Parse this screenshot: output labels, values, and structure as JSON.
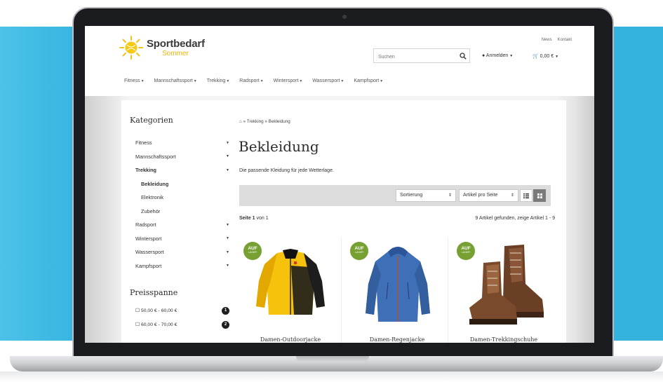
{
  "colors": {
    "accent": "#e9b40c",
    "badge": "#77a033",
    "backdrop": "#35b3df"
  },
  "top_links": [
    "News",
    "Kontakt"
  ],
  "logo": {
    "title": "Sportbedarf",
    "subtitle": "Sommer",
    "icon": "sun-logo-icon"
  },
  "search": {
    "placeholder": "Suchen",
    "icon": "search-icon"
  },
  "account": {
    "label": "Anmelden",
    "icon": "user-icon"
  },
  "cart": {
    "label": "0,00 €",
    "icon": "cart-icon"
  },
  "nav": [
    "Fitness",
    "Mannschaftssport",
    "Trekking",
    "Radsport",
    "Wintersport",
    "Wassersport",
    "Kampfsport"
  ],
  "sidebar": {
    "heading": "Kategorien",
    "items": [
      {
        "label": "Fitness"
      },
      {
        "label": "Mannschaftssport"
      },
      {
        "label": "Trekking"
      },
      {
        "label": "Bekleidung"
      },
      {
        "label": "Elektronik"
      },
      {
        "label": "Zubehör"
      },
      {
        "label": "Radsport"
      },
      {
        "label": "Wintersport"
      },
      {
        "label": "Wassersport"
      },
      {
        "label": "Kampfsport"
      }
    ],
    "price_heading": "Preisspanne",
    "prices": [
      {
        "label": "50,00 € - 60,00 €",
        "count": "1"
      },
      {
        "label": "60,00 € - 70,00 €",
        "count": "2"
      }
    ]
  },
  "breadcrumb": {
    "home_icon": "home-icon",
    "text": "» Trekking » Bekleidung"
  },
  "page": {
    "title": "Bekleidung",
    "description": "Die passende Kleidung für jede Wetterlage."
  },
  "toolbar": {
    "sort": "Sortierung",
    "per_page": "Artikel pro Seite",
    "list_icon": "list-view-icon",
    "grid_icon": "grid-view-icon"
  },
  "results": {
    "page_label": "Seite 1",
    "page_suffix": "von 1",
    "found": "9 Artikel gefunden, zeige Artikel 1 - 9"
  },
  "products": [
    {
      "badge_top": "AUF",
      "badge_bottom": "LAGER",
      "name": "Damen-Outdoorjacke",
      "image": "yellow-jacket-image"
    },
    {
      "badge_top": "AUF",
      "badge_bottom": "LAGER",
      "name": "Damen-Regenjacke",
      "image": "blue-jacket-image"
    },
    {
      "badge_top": "AUF",
      "badge_bottom": "LAGER",
      "name": "Damen-Trekkingschuhe",
      "image": "hiking-boots-image"
    }
  ]
}
